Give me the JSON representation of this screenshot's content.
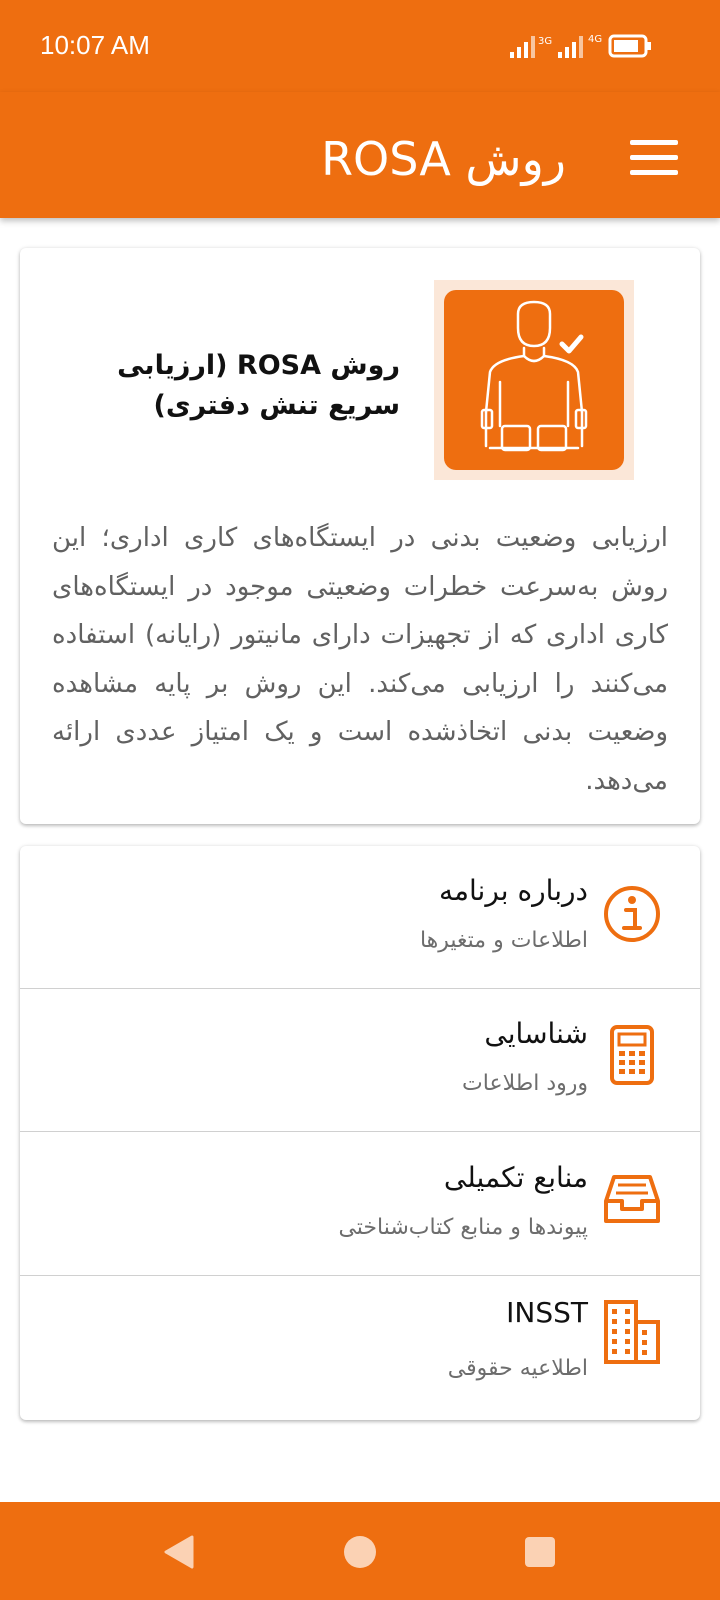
{
  "status_bar": {
    "time": "10:07 AM"
  },
  "app_bar": {
    "title": "روش ROSA",
    "menu_icon": "hamburger-menu-icon"
  },
  "info_card": {
    "image_icon": "seated-worker-check-icon",
    "title": "روش ROSA (ارزیابی سریع تنش دفتری)",
    "description": "ارزیابی وضعیت بدنی در ایستگاه‌های کاری اداری؛ این روش به‌سرعت خطرات وضعیتی موجود در ایستگاه‌های کاری اداری که از تجهیزات دارای مانیتور (رایانه) استفاده می‌کنند را ارزیابی می‌کند. این روش بر پایه مشاهده وضعیت بدنی اتخاذشده است و یک امتیاز عددی ارائه می‌دهد."
  },
  "menu": [
    {
      "title": "درباره برنامه",
      "subtitle": "اطلاعات و متغیرها",
      "icon": "info-icon"
    },
    {
      "title": "شناسایی",
      "subtitle": "ورود اطلاعات",
      "icon": "calculator-icon"
    },
    {
      "title": "منابع تکمیلی",
      "subtitle": "پیوندها و منابع کتاب‌شناختی",
      "icon": "inbox-tray-icon"
    },
    {
      "title": "INSST",
      "subtitle": "اطلاعیه حقوقی",
      "icon": "building-icon"
    }
  ],
  "colors": {
    "accent": "#ee6e10",
    "text": "#111111",
    "muted": "#6d6d6d"
  }
}
